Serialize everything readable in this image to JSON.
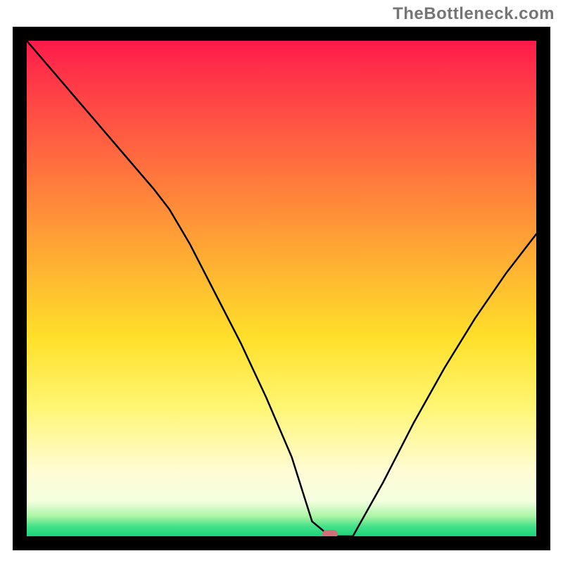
{
  "watermark": "TheBottleneck.com",
  "plot": {
    "inner_width": 724,
    "inner_height": 704,
    "marker": {
      "x_frac": 0.595,
      "y_frac": 0.996
    }
  },
  "chart_data": {
    "type": "line",
    "title": "",
    "xlabel": "",
    "ylabel": "",
    "xlim": [
      0,
      1
    ],
    "ylim": [
      0,
      1
    ],
    "annotations": [
      "TheBottleneck.com watermark top-right"
    ],
    "series": [
      {
        "name": "bottleneck-curve",
        "x": [
          0.0,
          0.05,
          0.1,
          0.15,
          0.2,
          0.25,
          0.28,
          0.32,
          0.37,
          0.42,
          0.47,
          0.52,
          0.56,
          0.595,
          0.64,
          0.7,
          0.76,
          0.82,
          0.88,
          0.94,
          1.0
        ],
        "y": [
          1.0,
          0.94,
          0.88,
          0.82,
          0.76,
          0.7,
          0.66,
          0.59,
          0.49,
          0.39,
          0.28,
          0.16,
          0.03,
          0.0,
          0.0,
          0.11,
          0.23,
          0.34,
          0.44,
          0.53,
          0.61
        ]
      }
    ],
    "marker": {
      "x": 0.595,
      "y": 0.0,
      "color": "#d1707a",
      "shape": "rounded-pill"
    },
    "background": {
      "type": "vertical-gradient",
      "stops": [
        {
          "pos": 0.0,
          "color": "#ff1a4b"
        },
        {
          "pos": 0.24,
          "color": "#ff6c3f"
        },
        {
          "pos": 0.42,
          "color": "#ffa734"
        },
        {
          "pos": 0.6,
          "color": "#ffe02a"
        },
        {
          "pos": 0.87,
          "color": "#fffcd6"
        },
        {
          "pos": 0.96,
          "color": "#a8f5a4"
        },
        {
          "pos": 1.0,
          "color": "#19d57a"
        }
      ]
    }
  }
}
